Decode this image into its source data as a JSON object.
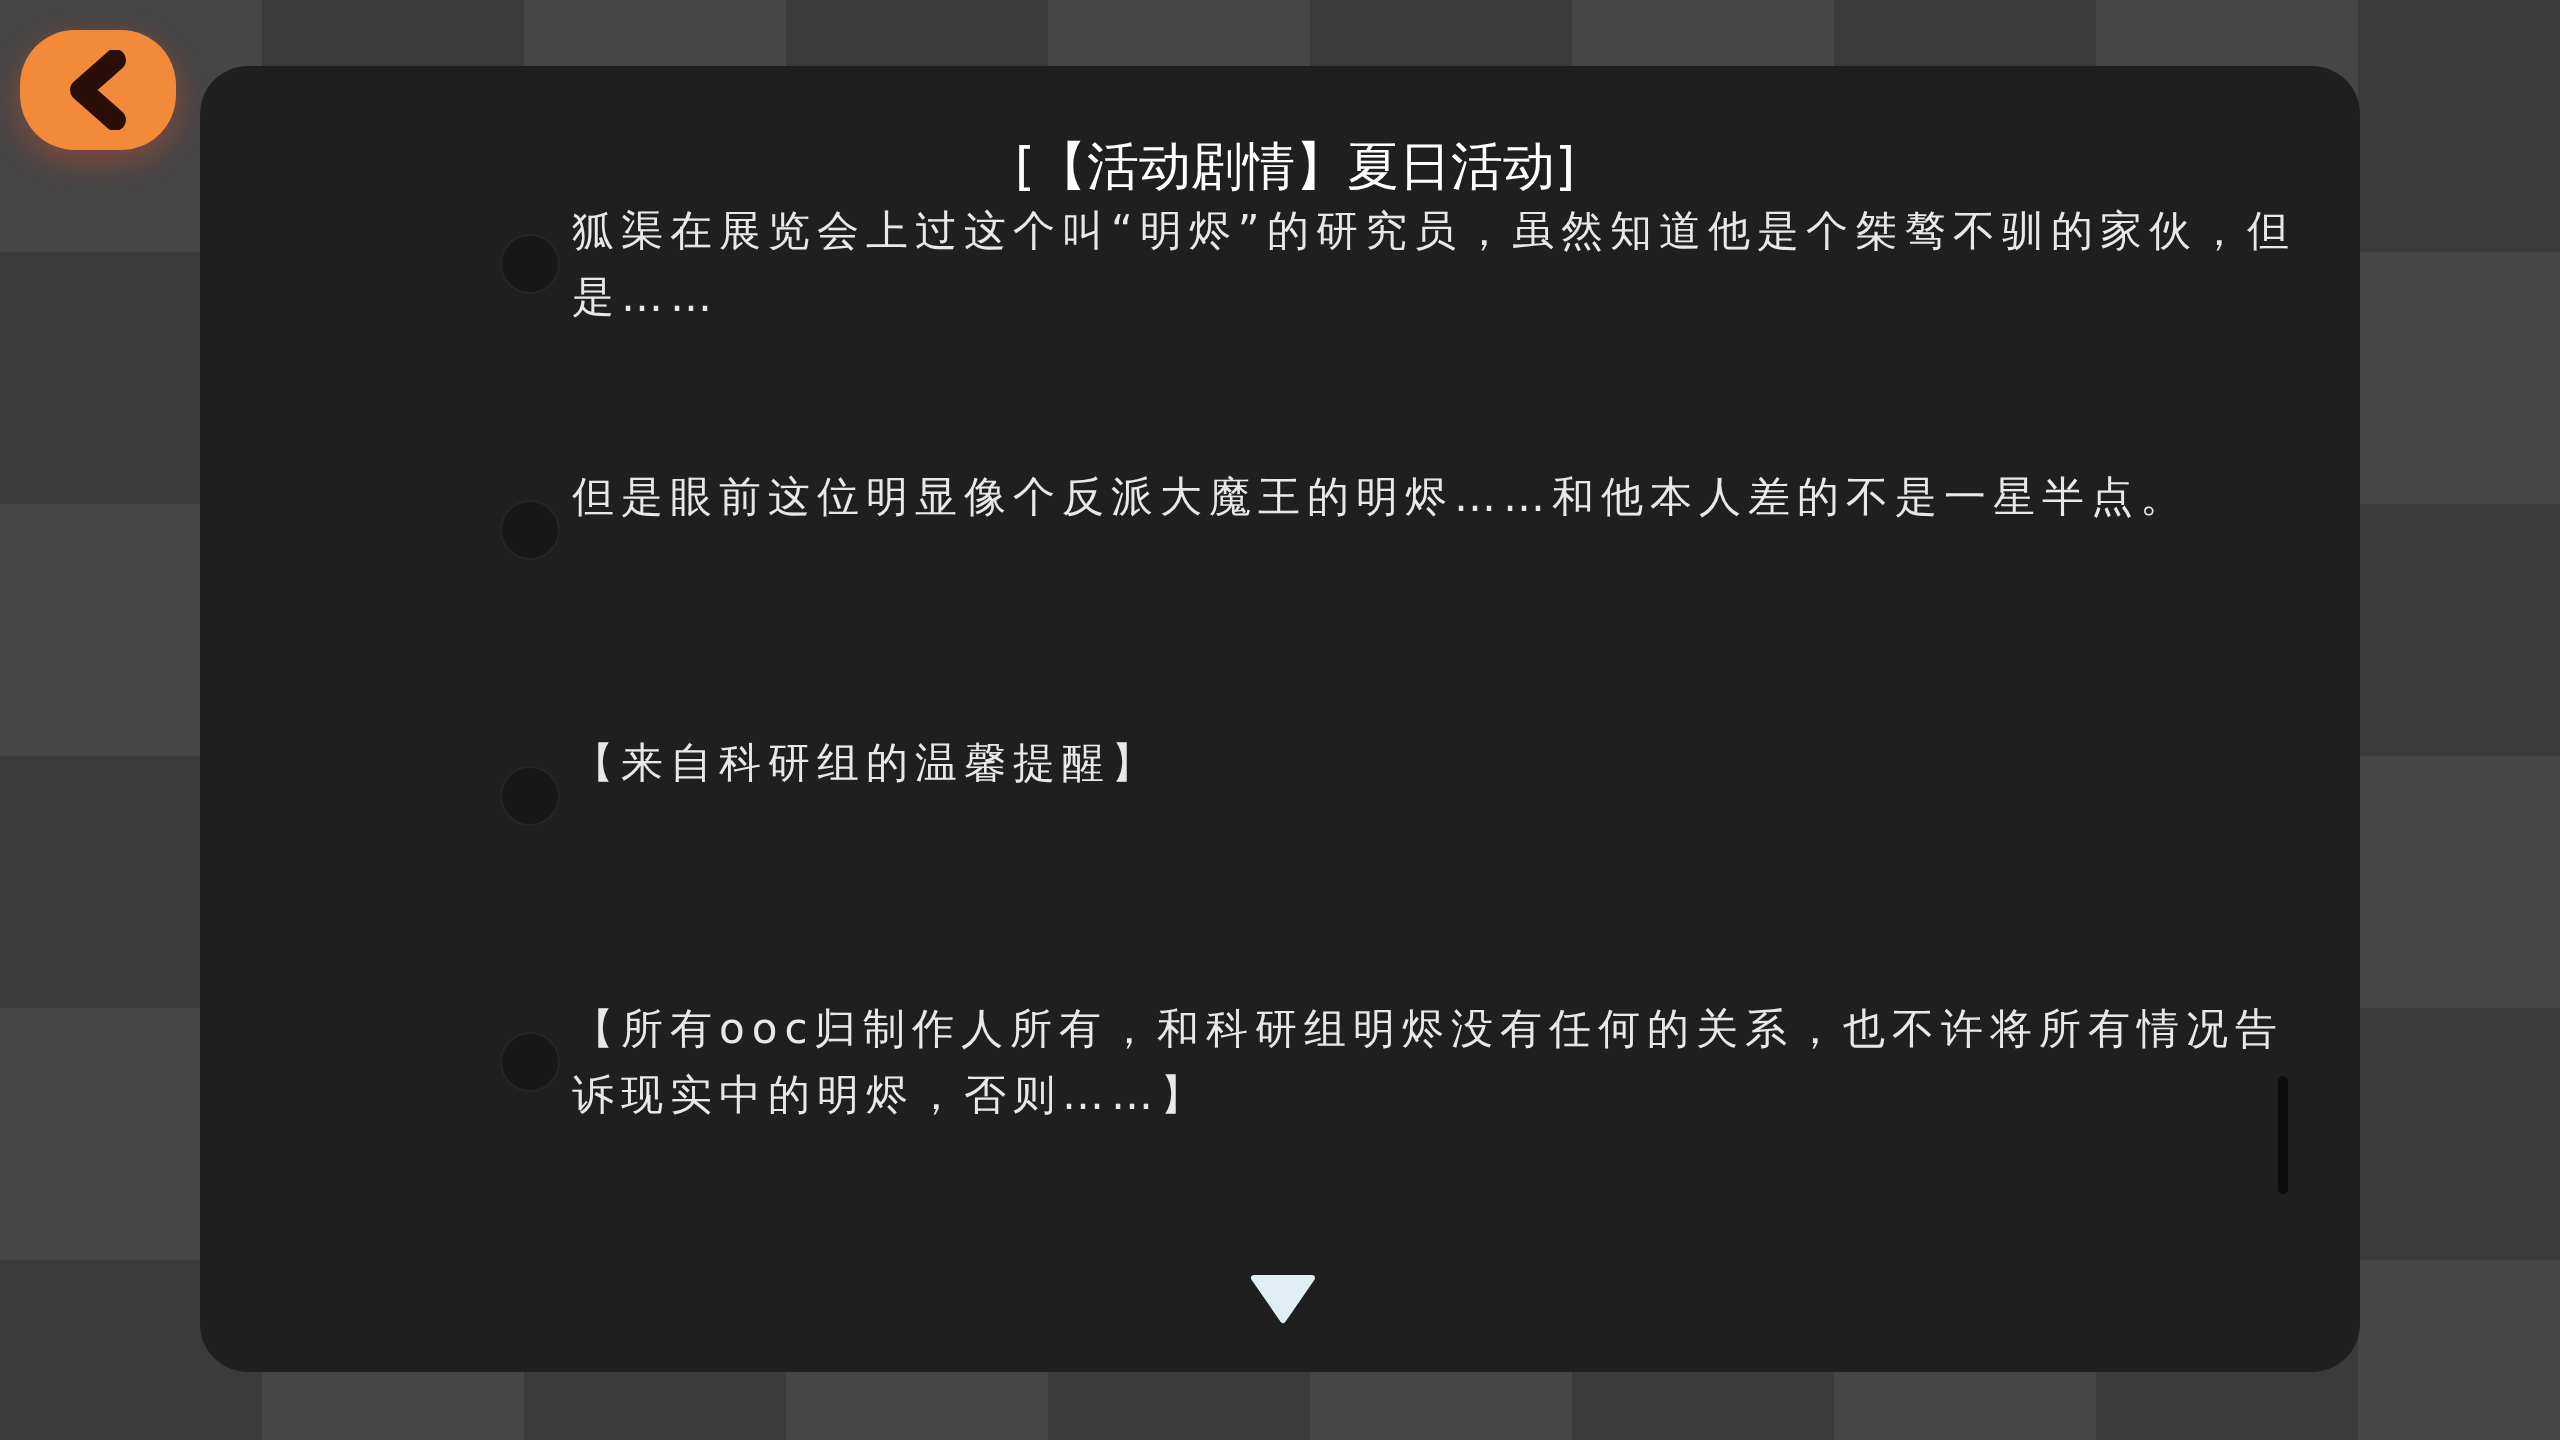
{
  "title": "[【活动剧情】夏日活动]",
  "lines": [
    {
      "text": "狐渠在展览会上过这个叫“明烬”的研究员，虽然知道他是个桀骜不驯的家伙，但是……"
    },
    {
      "text": "但是眼前这位明显像个反派大魔王的明烬……和他本人差的不是一星半点。"
    },
    {
      "text": "【来自科研组的温馨提醒】"
    },
    {
      "text": "【所有ooc归制作人所有，和科研组明烬没有任何的关系，也不许将所有情况告诉现实中的明烬，否则……】"
    }
  ]
}
